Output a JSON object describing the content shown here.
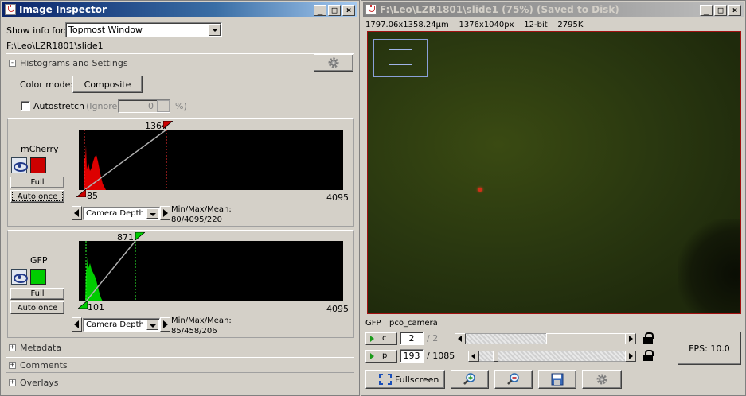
{
  "inspector": {
    "title": "Image Inspector",
    "show_info_label": "Show info for:",
    "show_info_value": "Topmost Window",
    "path": "F:\\Leo\\LZR1801\\slide1",
    "histograms": {
      "header": "Histograms and Settings",
      "color_mode_label": "Color mode:",
      "color_mode_value": "Composite",
      "autostretch_label": "Autostretch",
      "ignore_label": "(Ignore",
      "ignore_value": "0",
      "percent_label": "%)"
    },
    "channels": [
      {
        "name": "mCherry",
        "color": "#cc0000",
        "max_marker": "1364",
        "min_marker": "85",
        "axis_max": "4095",
        "full_label": "Full",
        "auto_label": "Auto once",
        "depth_value": "Camera Depth",
        "stats_label": "Min/Max/Mean:",
        "stats_value": "80/4095/220"
      },
      {
        "name": "GFP",
        "color": "#00cc00",
        "max_marker": "871",
        "min_marker": "101",
        "axis_max": "4095",
        "full_label": "Full",
        "auto_label": "Auto once",
        "depth_value": "Camera Depth",
        "stats_label": "Min/Max/Mean:",
        "stats_value": "85/458/206"
      }
    ],
    "sections": [
      "Metadata",
      "Comments",
      "Overlays"
    ]
  },
  "viewer": {
    "title": "F:\\Leo\\LZR1801\\slide1 (75%) (Saved to Disk)",
    "info_size_um": "1797.06x1358.24μm",
    "info_size_px": "1376x1040px",
    "info_bits": "12-bit",
    "info_filesize": "2795K",
    "channel_label": "GFP",
    "camera_label": "pco_camera",
    "c_axis": {
      "label": "c",
      "value": "2",
      "total": "/ 2"
    },
    "p_axis": {
      "label": "p",
      "value": "193",
      "total": "/ 1085"
    },
    "fps_label": "FPS: 10.0",
    "fullscreen_label": "Fullscreen"
  }
}
